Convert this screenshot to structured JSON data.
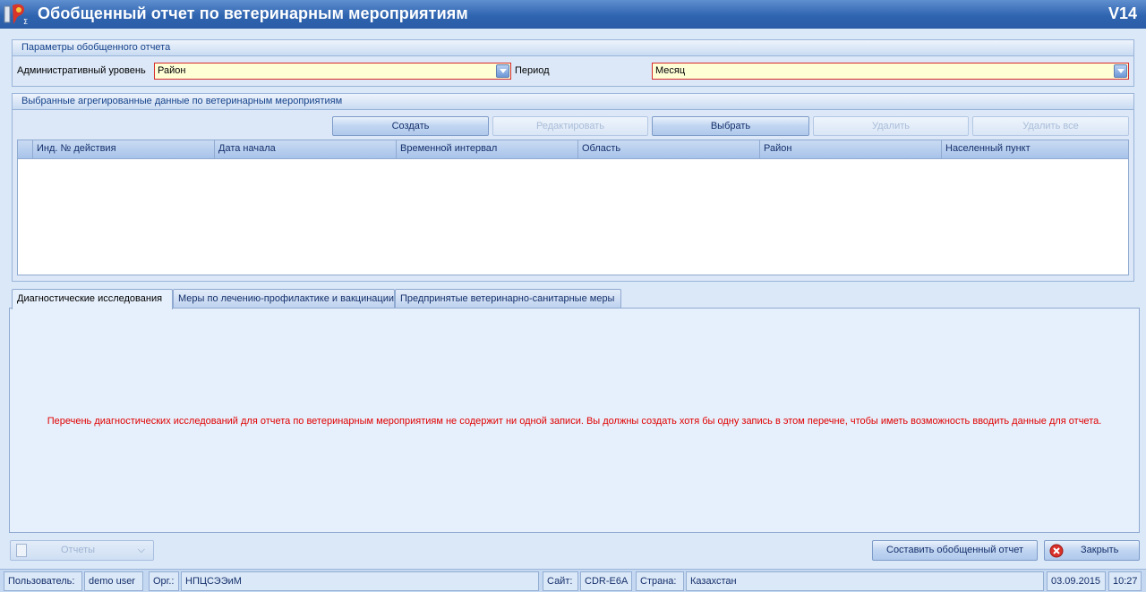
{
  "window": {
    "title": "Обобщенный отчет по ветеринарным мероприятиям",
    "version": "V14"
  },
  "params": {
    "header": "Параметры обобщенного отчета",
    "admin_level_label": "Административный уровень",
    "admin_level_value": "Район",
    "period_label": "Период",
    "period_value": "Месяц"
  },
  "aggregated": {
    "header": "Выбранные агрегированные данные по ветеринарным мероприятиям",
    "buttons": {
      "create": "Создать",
      "edit": "Редактировать",
      "select": "Выбрать",
      "delete": "Удалить",
      "delete_all": "Удалить все"
    },
    "columns": [
      "Инд. № действия",
      "Дата начала",
      "Временной интервал",
      "Область",
      "Район",
      "Населенный пункт"
    ],
    "rows": []
  },
  "tabs": [
    {
      "label": "Диагностические исследования",
      "active": true
    },
    {
      "label": "Меры по лечению-профилактике и вакцинации",
      "active": false
    },
    {
      "label": "Предпринятые ветеринарно-санитарные меры",
      "active": false
    }
  ],
  "tab_message": "Перечень диагностических исследований для отчета по ветеринарным мероприятиям не содержит ни одной записи. Вы должны создать хотя бы одну запись в этом перечне, чтобы иметь возможность вводить данные для отчета.",
  "footer": {
    "reports_label": "Отчеты",
    "compose_button": "Составить обобщенный отчет",
    "close_button": "Закрыть"
  },
  "status": {
    "user_label": "Пользователь:",
    "user_value": "demo user",
    "org_label": "Орг.:",
    "org_value": "НПЦСЭЭиМ",
    "site_label": "Сайт:",
    "site_value": "CDR-E6A",
    "country_label": "Страна:",
    "country_value": "Казахстан",
    "date": "03.09.2015",
    "time": "10:27"
  },
  "colors": {
    "title_bar": "#2f64b0",
    "required_border": "#d42a2a",
    "required_fill": "#ffffd6",
    "warning_text": "#e00000"
  }
}
